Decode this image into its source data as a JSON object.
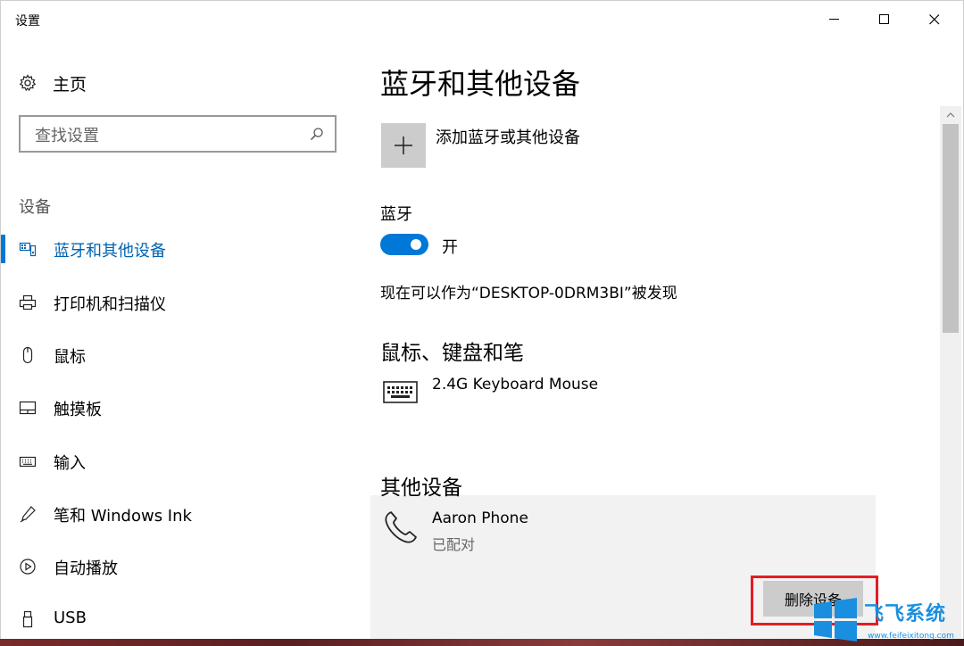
{
  "window": {
    "title": "设置"
  },
  "sidebar": {
    "home_label": "主页",
    "search_placeholder": "查找设置",
    "section_label": "设备",
    "items": [
      {
        "label": "蓝牙和其他设备",
        "icon": "bluetooth-devices-icon",
        "active": true
      },
      {
        "label": "打印机和扫描仪",
        "icon": "printer-icon",
        "active": false
      },
      {
        "label": "鼠标",
        "icon": "mouse-icon",
        "active": false
      },
      {
        "label": "触摸板",
        "icon": "touchpad-icon",
        "active": false
      },
      {
        "label": "输入",
        "icon": "keyboard-icon",
        "active": false
      },
      {
        "label": "笔和 Windows Ink",
        "icon": "pen-icon",
        "active": false
      },
      {
        "label": "自动播放",
        "icon": "autoplay-icon",
        "active": false
      },
      {
        "label": "USB",
        "icon": "usb-icon",
        "active": false
      }
    ]
  },
  "main": {
    "title": "蓝牙和其他设备",
    "add_device_label": "添加蓝牙或其他设备",
    "bluetooth_label": "蓝牙",
    "bluetooth_state": "开",
    "discoverable_text": "现在可以作为“DESKTOP-0DRM3BI”被发现",
    "mouse_section_title": "鼠标、键盘和笔",
    "mouse_device_name": "2.4G Keyboard Mouse",
    "other_section_title": "其他设备",
    "other_device_name": "Aaron Phone",
    "other_device_status": "已配对",
    "remove_button_label": "删除设备"
  },
  "watermark": {
    "text": "飞飞系统",
    "url": "www.feifeixitong.com"
  },
  "colors": {
    "accent": "#0078d7",
    "highlight": "#e51c23"
  }
}
